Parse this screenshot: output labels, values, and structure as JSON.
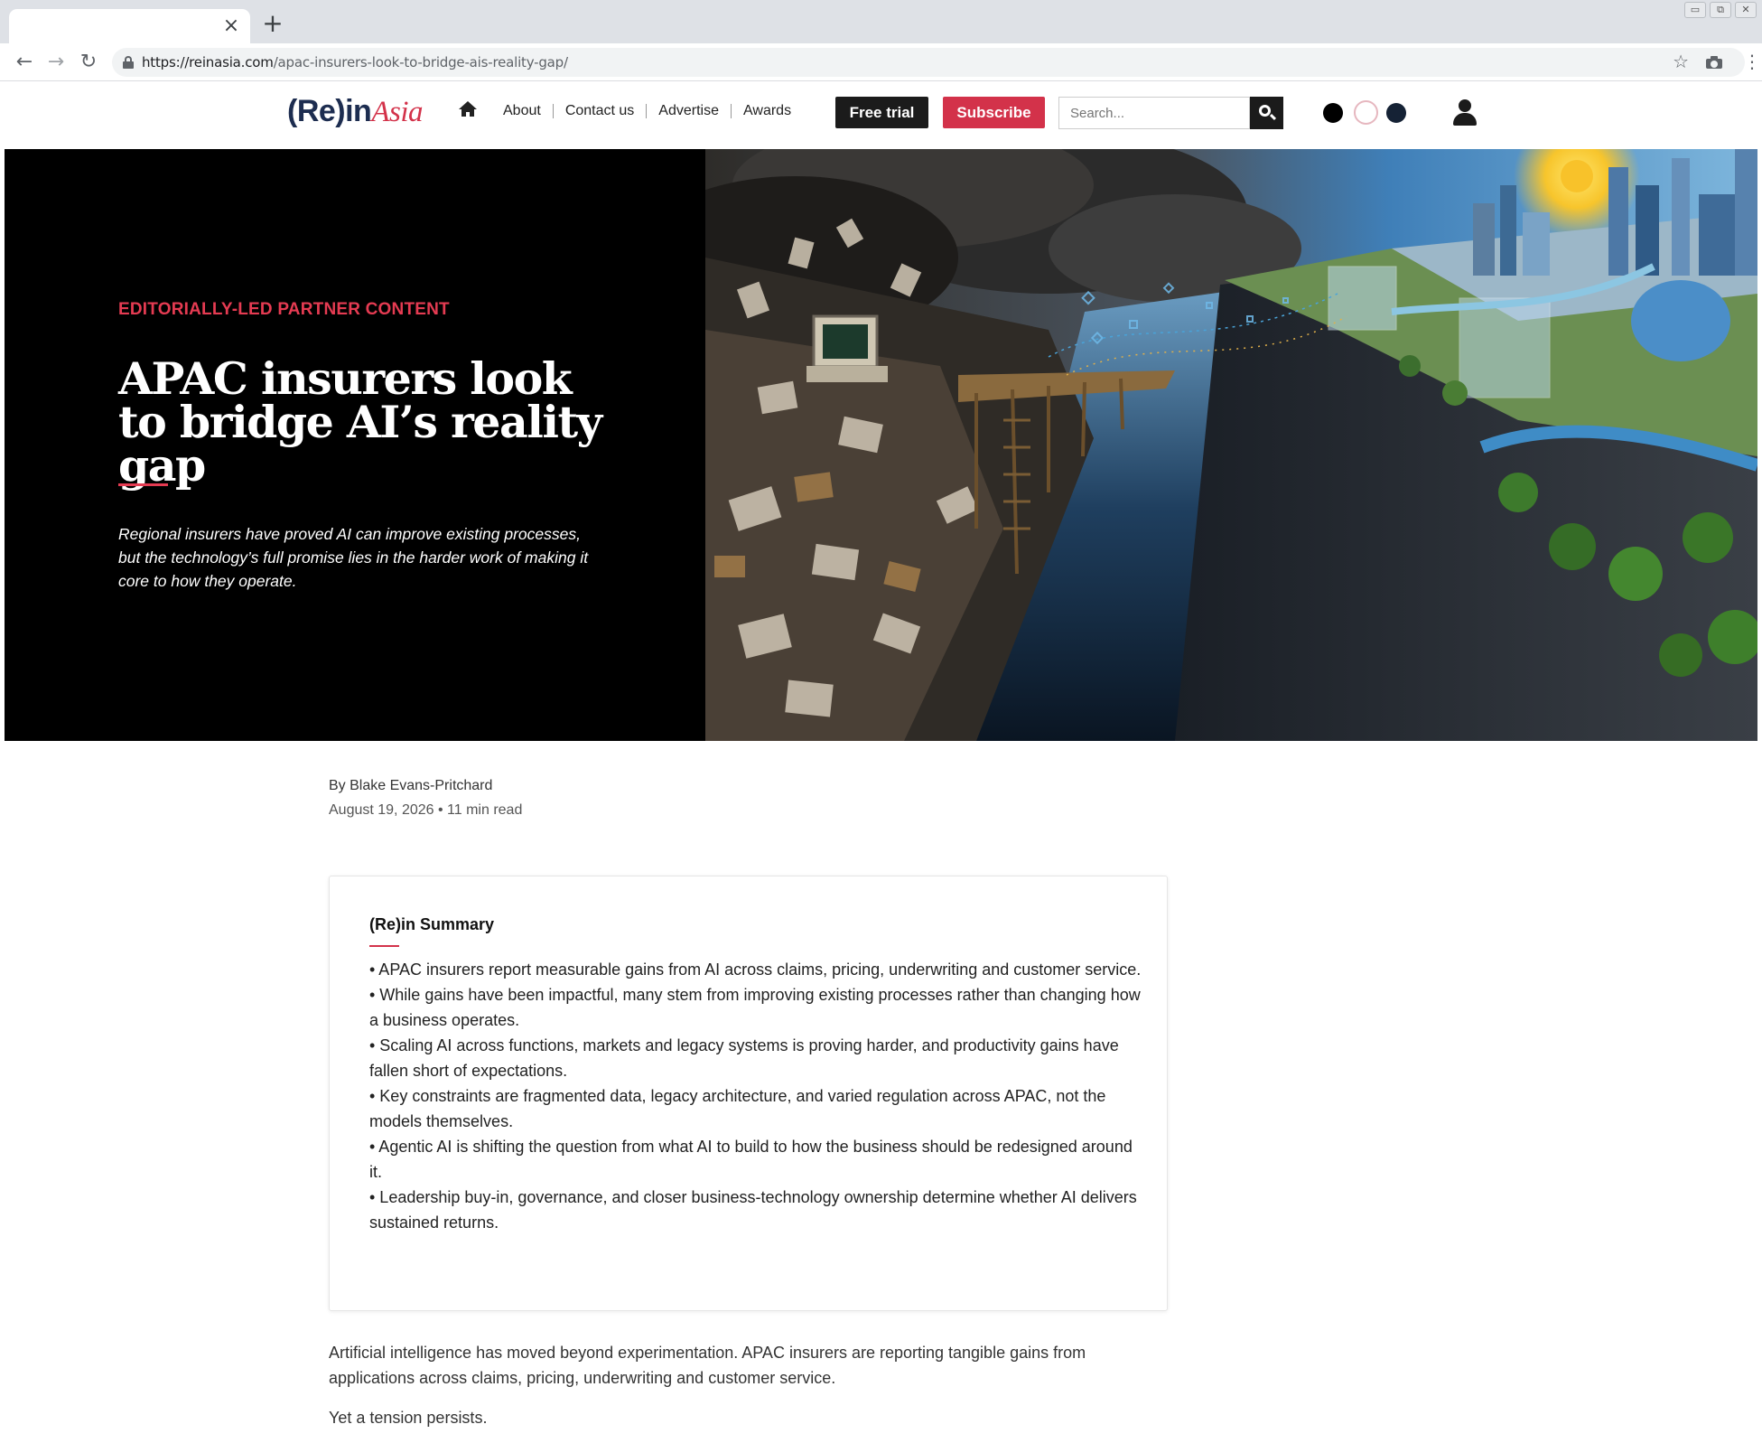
{
  "browser": {
    "tab_close": "×",
    "new_tab": "+",
    "url_host": "https://reinasia.com",
    "url_path": "/apac-insurers-look-to-bridge-ais-reality-gap/"
  },
  "header": {
    "logo_main": "(Re)in",
    "logo_script": "Asia",
    "menu": [
      "About",
      "Contact us",
      "Advertise",
      "Awards"
    ],
    "free_trial": "Free trial",
    "subscribe": "Subscribe",
    "search_placeholder": "Search...",
    "theme_colors": [
      "#000000",
      "#ffffff",
      "#152235"
    ]
  },
  "hero": {
    "kicker": "EDITORIALLY-LED PARTNER CONTENT",
    "headline": "APAC insurers look to bridge AI’s reality gap",
    "dek": "Regional insurers have proved AI can improve existing processes, but the technology’s full promise lies in the harder work of making it core to how they operate."
  },
  "article": {
    "byline": "By Blake Evans-Pritchard",
    "meta": "August 19, 2026 • 11 min read",
    "summary_title": "(Re)in Summary",
    "summary_items": [
      "• APAC insurers report measurable gains from AI across claims, pricing, underwriting and customer service.",
      "• While gains have been impactful, many stem from improving existing processes rather than changing how a business operates.",
      "• Scaling AI across functions, markets and legacy systems is proving harder, and productivity gains have fallen short of expectations.",
      "• Key constraints are fragmented data, legacy architecture, and varied regulation across APAC, not the models themselves.",
      "• Agentic AI is shifting the question from what AI to build to how the business should be redesigned around it.",
      "• Leadership buy-in, governance, and closer business-technology ownership determine whether AI delivers sustained returns."
    ],
    "body": [
      "Artificial intelligence has moved beyond experimentation. APAC insurers are reporting tangible gains from applications across claims, pricing, underwriting and customer service.",
      "Yet a tension persists."
    ]
  },
  "colors": {
    "accent_red": "#d3324a",
    "kicker_red": "#e53b52",
    "dark": "#1b1b1b"
  }
}
